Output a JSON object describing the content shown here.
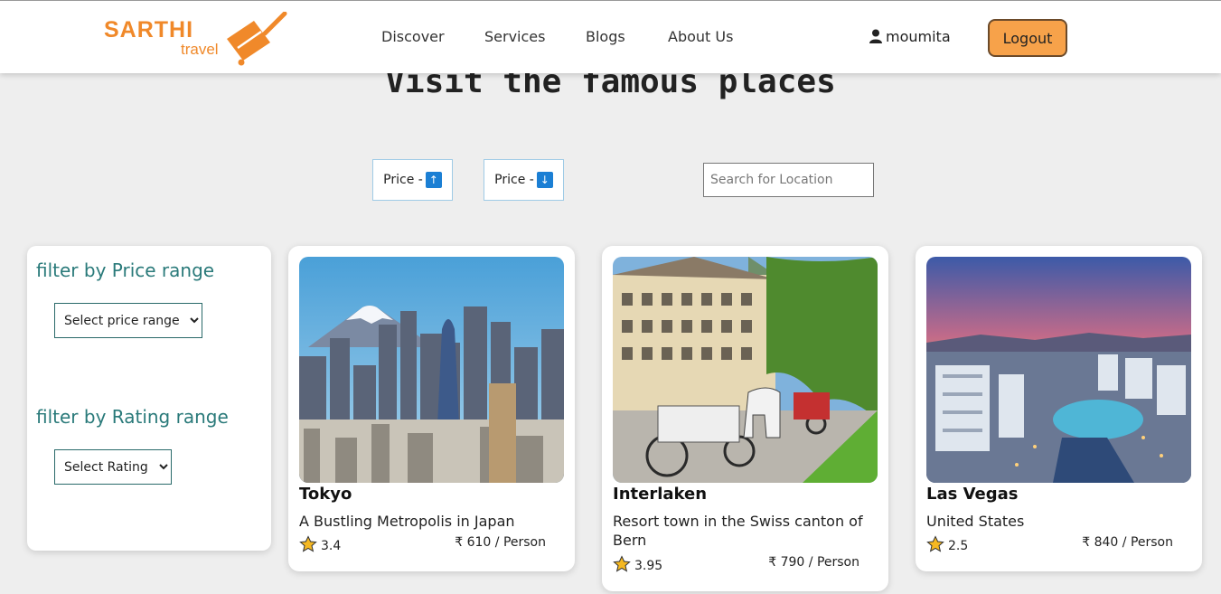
{
  "brand": {
    "name": "SARTHI",
    "tagline": "travel"
  },
  "nav": {
    "links": [
      "Discover",
      "Services",
      "Blogs",
      "About Us"
    ]
  },
  "user": {
    "username": "moumita",
    "logout_label": "Logout"
  },
  "page": {
    "title": "Visit the famous places"
  },
  "sort": {
    "price_asc_label": "Price -",
    "price_asc_icon": "↑",
    "price_desc_label": "Price -",
    "price_desc_icon": "↓"
  },
  "search": {
    "placeholder": "Search for Location"
  },
  "filters": {
    "price_title": "filter by Price range",
    "price_select": "Select price range",
    "rating_title": "filter by Rating range",
    "rating_select": "Select Rating"
  },
  "places": [
    {
      "name": "Tokyo",
      "description": "A Bustling Metropolis in Japan",
      "rating": "3.4",
      "price": "₹ 610 / Person",
      "image": "tokyo-skyline-with-mount-fuji"
    },
    {
      "name": "Interlaken",
      "description": "Resort town in the Swiss canton of Bern",
      "rating": "3.95",
      "price": "₹ 790 / Person",
      "image": "interlaken-horse-carriages-street"
    },
    {
      "name": "Las Vegas",
      "description": "United States",
      "rating": "2.5",
      "price": "₹ 840 / Person",
      "image": "las-vegas-aerial-sunset"
    }
  ],
  "colors": {
    "brand_orange": "#f0892a",
    "logout_bg": "#f7a24a",
    "filter_title": "#2a7a7a",
    "sort_border": "#9fcbe6",
    "arrow_blue": "#1b7fd4"
  }
}
